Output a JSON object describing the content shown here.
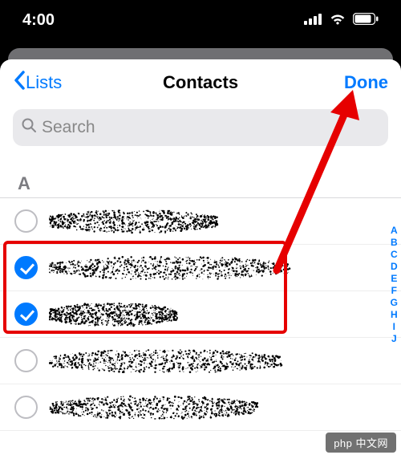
{
  "statusbar": {
    "time": "4:00"
  },
  "nav": {
    "back": "Lists",
    "title": "Contacts",
    "done": "Done"
  },
  "search": {
    "placeholder": "Search"
  },
  "section": {
    "letter": "A"
  },
  "contacts": [
    {
      "selected": false
    },
    {
      "selected": true
    },
    {
      "selected": true
    },
    {
      "selected": false
    },
    {
      "selected": false
    }
  ],
  "index": [
    "A",
    "B",
    "C",
    "D",
    "E",
    "F",
    "G",
    "H",
    "I",
    "J"
  ],
  "watermark": "php 中文网"
}
